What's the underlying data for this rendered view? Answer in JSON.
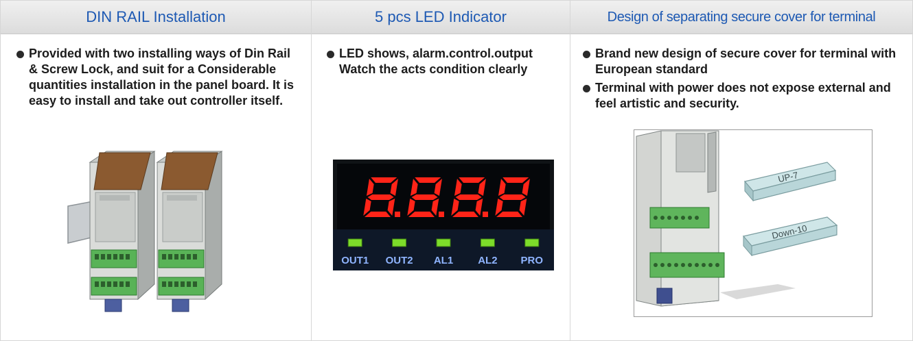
{
  "columns": [
    {
      "title": "DIN RAIL Installation",
      "bullets": [
        "Provided with two installing ways of Din Rail & Screw Lock, and suit for a Considerable quantities installation in the panel board. It is easy to install and take out controller itself."
      ],
      "image": "din-rail-controllers-photo"
    },
    {
      "title": "5 pcs LED Indicator",
      "bullets": [
        "LED shows, alarm.control.output Watch the acts condition clearly"
      ],
      "display": {
        "digits": "8.8.8.8",
        "indicators": [
          "OUT1",
          "OUT2",
          "AL1",
          "AL2",
          "PRO"
        ]
      }
    },
    {
      "title": "Design of separating secure cover for terminal",
      "bullets": [
        "Brand new design of secure cover for terminal with European standard",
        "Terminal with power does not expose external and feel artistic and security."
      ],
      "cover_labels": [
        "UP-7",
        "Down-10"
      ]
    }
  ],
  "colors": {
    "header_text": "#1d59b3",
    "led_red": "#ff2418",
    "led_green": "#7ddc2a",
    "display_label": "#8fb4ff"
  }
}
